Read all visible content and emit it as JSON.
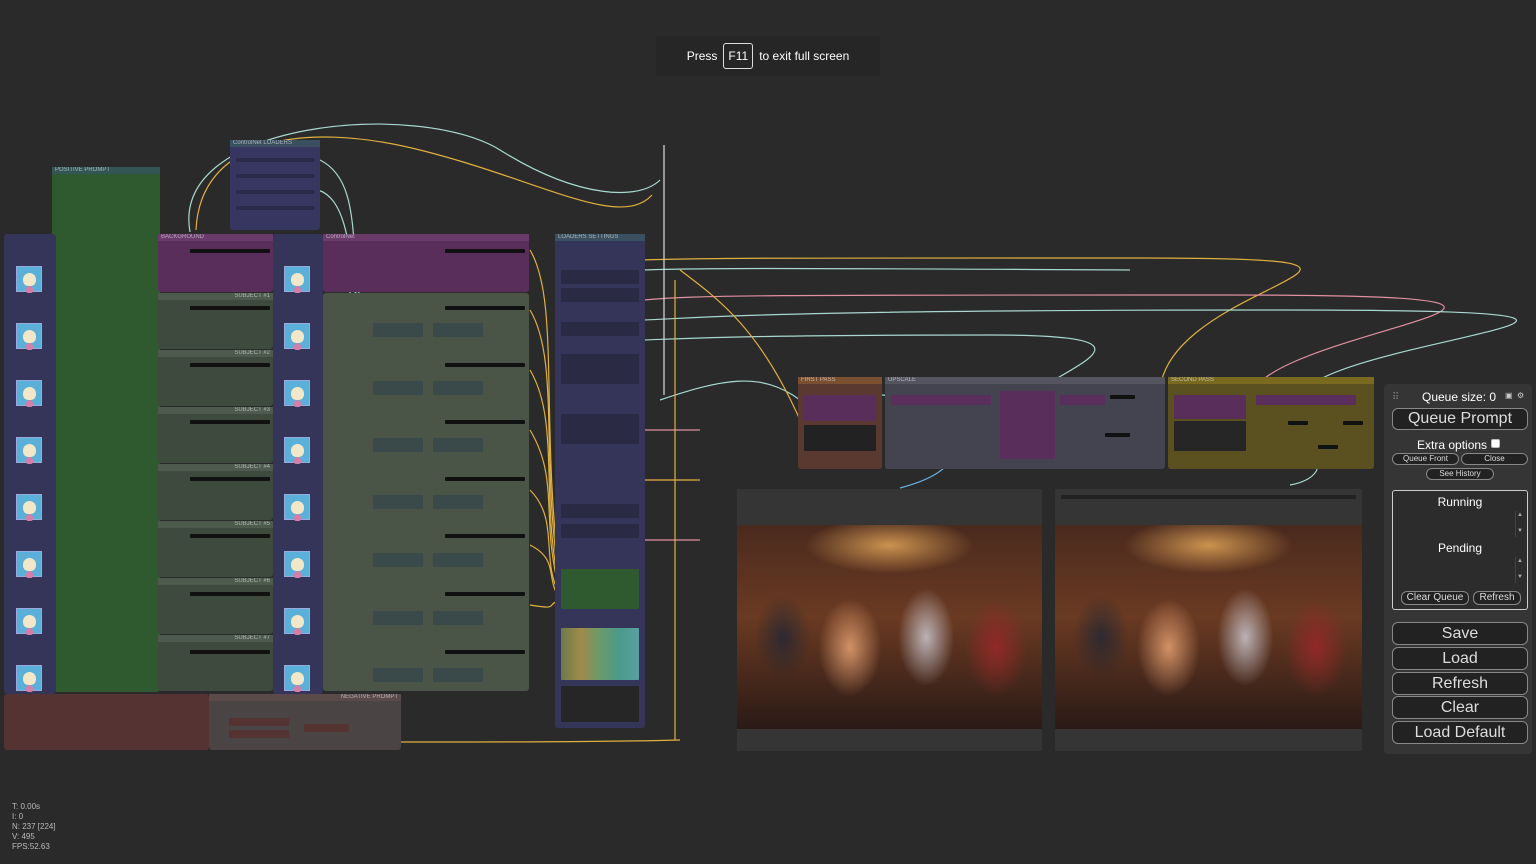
{
  "toast": {
    "before": "Press",
    "key": "F11",
    "after": "to exit full screen"
  },
  "groups": {
    "positive_prompt": "POSITIVE PROMPT",
    "controlnet_loaders": "ControlNet LOADERS",
    "background": "BACKGROUND",
    "controlnet": "ControlNet",
    "loaders_settings": "LOADERS SETTINGS",
    "subjects": [
      "SUBJECT #1",
      "SUBJECT #2",
      "SUBJECT #3",
      "SUBJECT #4",
      "SUBJECT #5",
      "SUBJECT #6",
      "SUBJECT #7"
    ],
    "negative_prompt": "NEGATIVE PROMPT",
    "first_pass": "FIRST PASS",
    "upscale": "UPSCALE",
    "second_pass": "SECOND PASS"
  },
  "menu": {
    "queue_size": "Queue size: 0",
    "queue_prompt": "Queue Prompt",
    "extra_options": "Extra options",
    "queue_front": "Queue Front",
    "close": "Close",
    "see_history": "See History",
    "running": "Running",
    "pending": "Pending",
    "clear_queue": "Clear Queue",
    "refresh_small": "Refresh",
    "save": "Save",
    "load": "Load",
    "refresh": "Refresh",
    "clear": "Clear",
    "load_default": "Load Default",
    "icons": {
      "image": "image-icon",
      "settings": "gear-icon"
    }
  },
  "stats": {
    "t": "T: 0.00s",
    "i": "I: 0",
    "n": "N: 237 [224]",
    "v": "V: 495",
    "fps": "FPS:52.63"
  },
  "colors": {
    "green": "#335533",
    "purple": "#553355",
    "blue": "#335",
    "gray": "#444",
    "olive": "#665533",
    "red": "#553333"
  }
}
